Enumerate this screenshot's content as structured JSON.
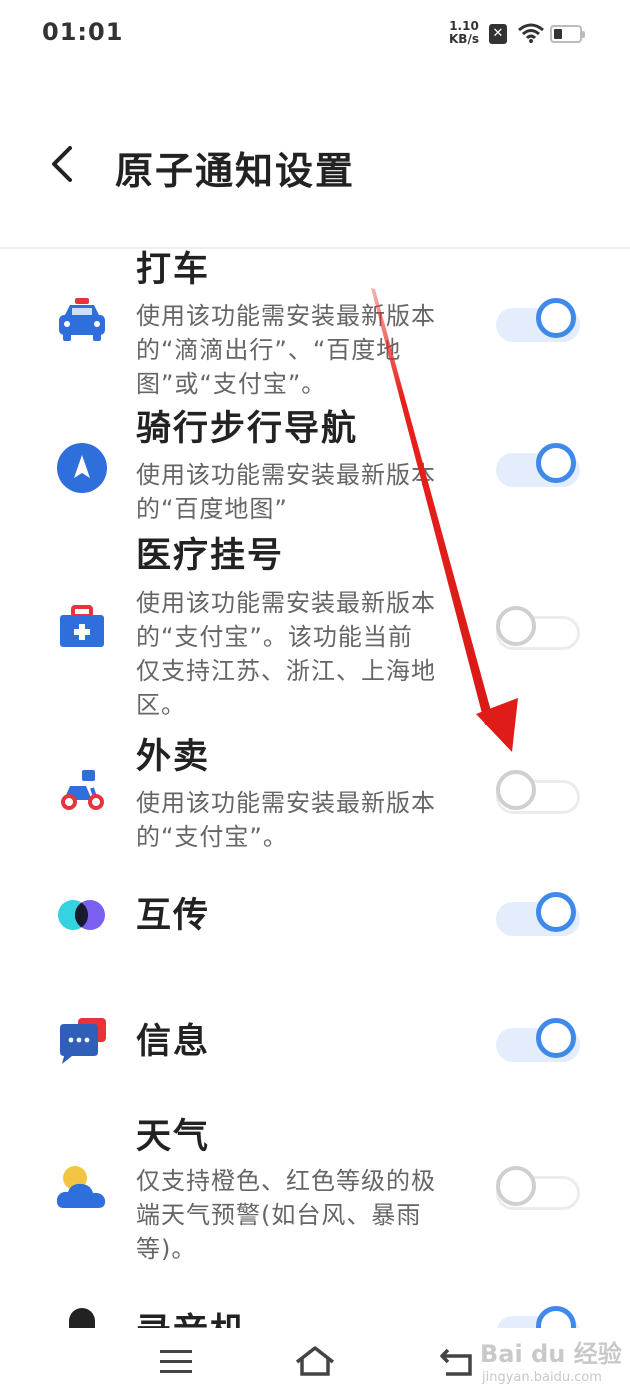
{
  "status_bar": {
    "time": "01:01",
    "speed_value": "1.10",
    "speed_unit": "KB/s",
    "sim_icon": "no-sim-icon",
    "wifi_icon": "wifi-icon",
    "battery_icon": "battery-icon"
  },
  "header": {
    "back_icon": "back-chevron-icon",
    "title": "原子通知设置"
  },
  "items": [
    {
      "icon": "taxi-icon",
      "title": "打车",
      "desc": "使用该功能需安装最新版本的“滴滴出行”、“百度地图”或“支付宝”。",
      "enabled": true
    },
    {
      "icon": "navigation-icon",
      "title": "骑行步行导航",
      "desc": "使用该功能需安装最新版本的“百度地图”",
      "enabled": true
    },
    {
      "icon": "medical-kit-icon",
      "title": "医疗挂号",
      "desc": "使用该功能需安装最新版本的“支付宝”。该功能当前仅支持江苏、浙江、上海地区。",
      "enabled": false
    },
    {
      "icon": "scooter-icon",
      "title": "外卖",
      "desc": "使用该功能需安装最新版本的“支付宝”。",
      "enabled": false
    },
    {
      "icon": "transfer-icon",
      "title": "互传",
      "desc": "",
      "enabled": true
    },
    {
      "icon": "message-icon",
      "title": "信息",
      "desc": "",
      "enabled": true
    },
    {
      "icon": "weather-icon",
      "title": "天气",
      "desc": "仅支持橙色、红色等级的极端天气预警(如台风、暴雨等)。",
      "enabled": false
    },
    {
      "icon": "recorder-icon",
      "title": "录音机",
      "desc": "",
      "enabled": true
    }
  ],
  "nav_bar": {
    "menu_icon": "menu-icon",
    "home_icon": "home-icon",
    "back_icon": "return-icon"
  },
  "watermark": {
    "brand": "Bai du 经验",
    "url": "jingyan.baidu.com"
  },
  "colors": {
    "accent": "#3f8ae8",
    "toggle_track_on": "#e3edfb",
    "annotation_arrow": "#e8201c"
  }
}
